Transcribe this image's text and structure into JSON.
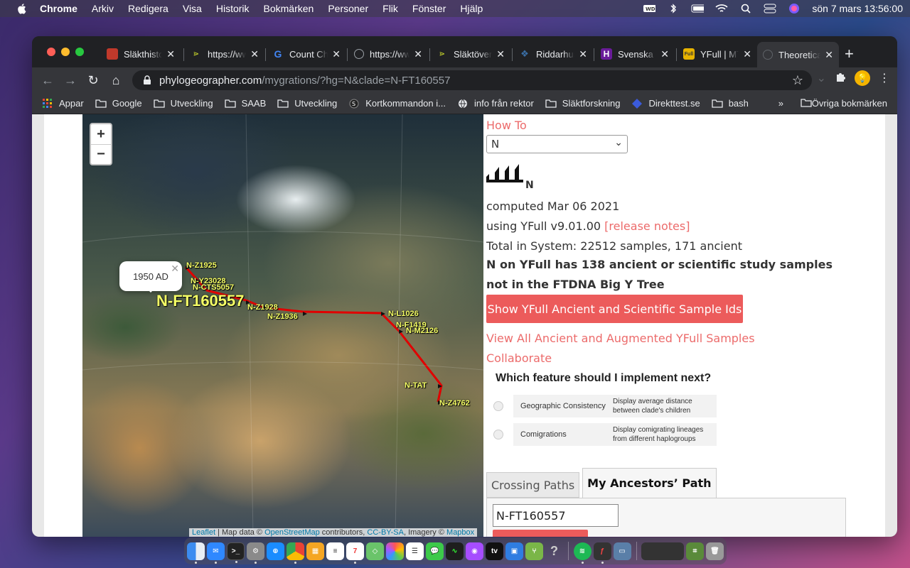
{
  "menubar": {
    "app_name": "Chrome",
    "menus": [
      "Arkiv",
      "Redigera",
      "Visa",
      "Historik",
      "Bokmärken",
      "Personer",
      "Flik",
      "Fönster",
      "Hjälp"
    ],
    "datetime": "sön 7 mars  13:56:00"
  },
  "tabs": [
    {
      "title": "Släkthistoria",
      "favicon_color": "#c0392b"
    },
    {
      "title": "https://www",
      "favicon_color": "#b5c22a"
    },
    {
      "title": "Count Characters",
      "favicon_color": "#4285f4"
    },
    {
      "title": "https://www",
      "favicon_color": "#888888"
    },
    {
      "title": "Släktöversikt",
      "favicon_color": "#b5c22a"
    },
    {
      "title": "Riddarhuset",
      "favicon_color": "#3a6ea5"
    },
    {
      "title": "Svenska",
      "favicon_color": "#6a1b9a"
    },
    {
      "title": "YFull | MTree",
      "favicon_color": "#e8b400"
    },
    {
      "title": "Theoretical",
      "favicon_color": "#555555"
    }
  ],
  "url": {
    "host": "phylogeographer.com",
    "path": "/mygrations/?hg=N&clade=N-FT160557"
  },
  "bookmarks": {
    "items": [
      "Appar",
      "Google",
      "Utveckling",
      "SAAB",
      "Utveckling",
      "Kortkommandon i...",
      "info från rektor",
      "Släktforskning",
      "Direkttest.se",
      "bash"
    ],
    "more": "»",
    "other": "Övriga bokmärken"
  },
  "map": {
    "popup_text": "1950 AD",
    "zoom_in": "+",
    "zoom_out": "−",
    "labels": {
      "z1925": "N-Z1925",
      "y23028": "N-Y23028",
      "cts5057": "N-CTS5057",
      "ft160557": "N-FT160557",
      "z1928": "N-Z1928",
      "z1936": "N-Z1936",
      "l1026": "N-L1026",
      "f1419": "N-F1419",
      "m2126": "N-M2126",
      "tat": "N-TAT",
      "z4762": "N-Z4762"
    },
    "attribution": {
      "leaflet": "Leaflet",
      "text1": " | Map data © ",
      "osm": "OpenStreetMap",
      "text2": " contributors, ",
      "license": "CC-BY-SA",
      "text3": ", Imagery © ",
      "mapbox": "Mapbox"
    }
  },
  "panel": {
    "how_to": "How To",
    "haplogroup_selected": "N",
    "logo_letter": "N",
    "computed": "computed Mar 06 2021",
    "using_prefix": "using YFull v9.01.00 ",
    "release_notes": "[release notes]",
    "total": "Total in System: 22512 samples, 171 ancient",
    "notice": "N on YFull has 138 ancient or scientific study samples not in the FTDNA Big Y Tree",
    "show_button": "Show YFull Ancient and Scientific Sample Ids",
    "view_all": "View All Ancient and Augmented YFull Samples",
    "collaborate": "Collaborate",
    "poll_title": "Which feature should I implement next?",
    "poll_options": [
      {
        "name": "Geographic Consistency",
        "desc1": "Display average distance",
        "desc2": "between clade's children"
      },
      {
        "name": "Comigrations",
        "desc1": "Display comigrating lineages",
        "desc2": "from different haplogroups"
      }
    ],
    "tab_crossing": "Crossing Paths",
    "tab_ancestors": "My Ancestors’ Path",
    "clade_value": "N-FT160557"
  }
}
